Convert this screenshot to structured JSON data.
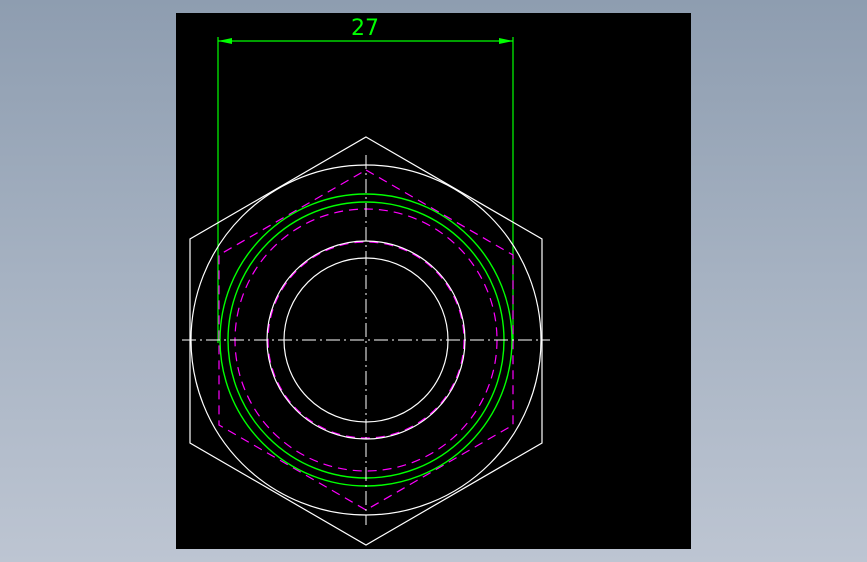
{
  "drawing": {
    "dimension_label": "27",
    "colors": {
      "background": "#000000",
      "outline": "#ffffff",
      "dimension": "#00ff00",
      "thread": "#00ff00",
      "hidden": "#ff00ff",
      "centerline": "#ffffff"
    }
  }
}
